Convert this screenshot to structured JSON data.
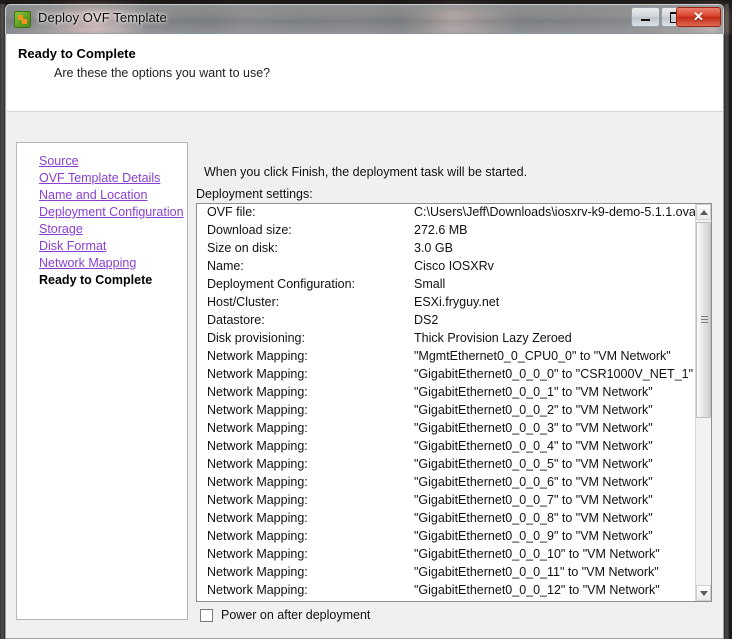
{
  "window": {
    "title": "Deploy OVF Template",
    "icon": "ovf-template-icon",
    "controls": {
      "minimize": "–",
      "maximize": "□",
      "close": "✕"
    }
  },
  "header": {
    "title": "Ready to Complete",
    "subtitle": "Are these the options you want to use?"
  },
  "sidebar": {
    "items": [
      {
        "label": "Source",
        "current": false
      },
      {
        "label": "OVF Template Details",
        "current": false
      },
      {
        "label": "Name and Location",
        "current": false
      },
      {
        "label": "Deployment Configuration",
        "current": false
      },
      {
        "label": "Storage",
        "current": false
      },
      {
        "label": "Disk Format",
        "current": false
      },
      {
        "label": "Network Mapping",
        "current": false
      },
      {
        "label": "Ready to Complete",
        "current": true
      }
    ]
  },
  "content": {
    "finish_note": "When you click Finish, the deployment task will be started.",
    "settings_label": "Deployment settings:",
    "rows": [
      {
        "key": "OVF file:",
        "value": "C:\\Users\\Jeff\\Downloads\\iosxrv-k9-demo-5.1.1.ova"
      },
      {
        "key": "Download size:",
        "value": "272.6 MB"
      },
      {
        "key": "Size on disk:",
        "value": "3.0 GB"
      },
      {
        "key": "Name:",
        "value": "Cisco IOSXRv"
      },
      {
        "key": "Deployment Configuration:",
        "value": "Small"
      },
      {
        "key": "Host/Cluster:",
        "value": "ESXi.fryguy.net"
      },
      {
        "key": "Datastore:",
        "value": "DS2"
      },
      {
        "key": "Disk provisioning:",
        "value": "Thick Provision Lazy Zeroed"
      },
      {
        "key": "Network Mapping:",
        "value": "\"MgmtEthernet0_0_CPU0_0\" to \"VM Network\""
      },
      {
        "key": "Network Mapping:",
        "value": "\"GigabitEthernet0_0_0_0\" to \"CSR1000V_NET_1\""
      },
      {
        "key": "Network Mapping:",
        "value": "\"GigabitEthernet0_0_0_1\" to \"VM Network\""
      },
      {
        "key": "Network Mapping:",
        "value": "\"GigabitEthernet0_0_0_2\" to \"VM Network\""
      },
      {
        "key": "Network Mapping:",
        "value": "\"GigabitEthernet0_0_0_3\" to \"VM Network\""
      },
      {
        "key": "Network Mapping:",
        "value": "\"GigabitEthernet0_0_0_4\" to \"VM Network\""
      },
      {
        "key": "Network Mapping:",
        "value": "\"GigabitEthernet0_0_0_5\" to \"VM Network\""
      },
      {
        "key": "Network Mapping:",
        "value": "\"GigabitEthernet0_0_0_6\" to \"VM Network\""
      },
      {
        "key": "Network Mapping:",
        "value": "\"GigabitEthernet0_0_0_7\" to \"VM Network\""
      },
      {
        "key": "Network Mapping:",
        "value": "\"GigabitEthernet0_0_0_8\" to \"VM Network\""
      },
      {
        "key": "Network Mapping:",
        "value": "\"GigabitEthernet0_0_0_9\" to \"VM Network\""
      },
      {
        "key": "Network Mapping:",
        "value": "\"GigabitEthernet0_0_0_10\" to \"VM Network\""
      },
      {
        "key": "Network Mapping:",
        "value": "\"GigabitEthernet0_0_0_11\" to \"VM Network\""
      },
      {
        "key": "Network Mapping:",
        "value": "\"GigabitEthernet0_0_0_12\" to \"VM Network\""
      }
    ],
    "power_on": {
      "label": "Power on after deployment",
      "checked": false
    }
  },
  "colors": {
    "link": "#8a3fd1",
    "close_button": "#d9422c",
    "window_body": "#f0f0f0"
  }
}
